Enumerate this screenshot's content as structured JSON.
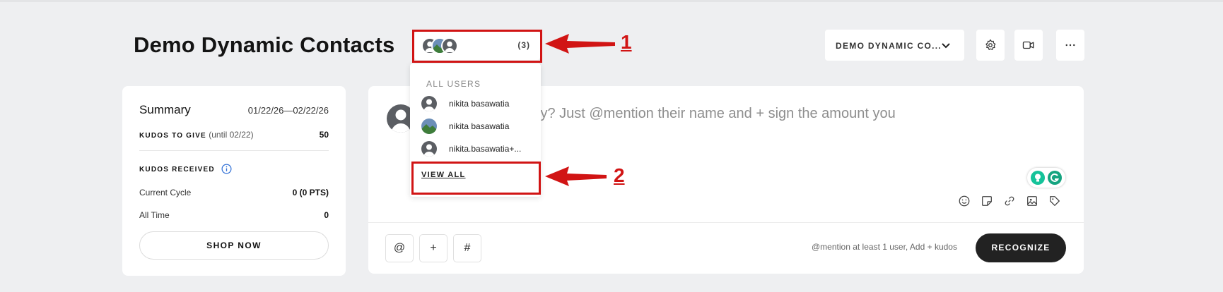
{
  "page": {
    "title": "Demo Dynamic Contacts",
    "members_count": "(3)",
    "context_select": "DEMO DYNAMIC CO...",
    "header_icons": [
      "gear-icon",
      "video-icon",
      "more-icon"
    ]
  },
  "dropdown": {
    "header": "ALL USERS",
    "users": [
      {
        "name": "nikita basawatia"
      },
      {
        "name": "nikita basawatia"
      },
      {
        "name": "nikita.basawatia+..."
      }
    ],
    "view_all": "VIEW ALL"
  },
  "summary": {
    "title": "Summary",
    "date_range": "01/22/26—02/22/26",
    "kudos_to_give_label": "KUDOS TO GIVE",
    "kudos_to_give_until": "(until 02/22)",
    "kudos_to_give_value": "50",
    "kudos_received_label": "KUDOS RECEIVED",
    "current_cycle_label": "Current Cycle",
    "current_cycle_value": "0 (0 PTS)",
    "all_time_label": "All Time",
    "all_time_value": "0",
    "shop_now": "SHOP NOW"
  },
  "composer": {
    "placeholder_visible": "to recognize today? Just @mention their name and + sign the amount you",
    "buttons": [
      "@",
      "+",
      "#"
    ],
    "hint": "@mention at least 1 user,  Add + kudos",
    "recognize": "RECOGNIZE",
    "tool_icons": [
      "emoji-icon",
      "sticker-icon",
      "link-icon",
      "image-icon",
      "tag-icon"
    ]
  },
  "annotations": {
    "one": "1",
    "two": "2",
    "color": "#d11414"
  }
}
